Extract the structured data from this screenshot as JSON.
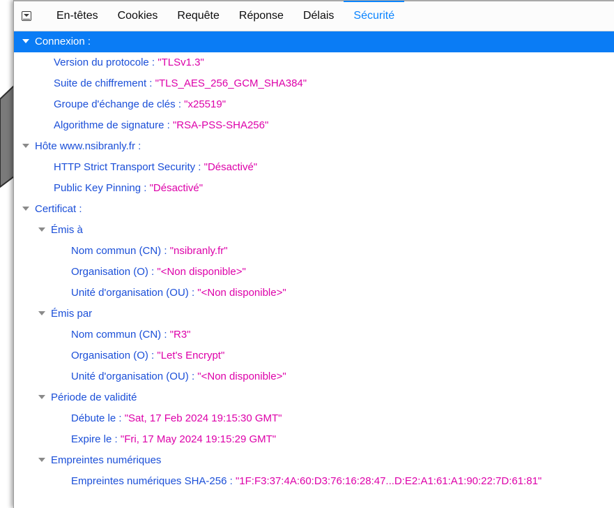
{
  "tabs": [
    {
      "label": "En-têtes",
      "active": false
    },
    {
      "label": "Cookies",
      "active": false
    },
    {
      "label": "Requête",
      "active": false
    },
    {
      "label": "Réponse",
      "active": false
    },
    {
      "label": "Délais",
      "active": false
    },
    {
      "label": "Sécurité",
      "active": true
    }
  ],
  "connexion": {
    "label": "Connexion :",
    "protocol": {
      "key": "Version du protocole : ",
      "value": "\"TLSv1.3\""
    },
    "cipher": {
      "key": "Suite de chiffrement : ",
      "value": "\"TLS_AES_256_GCM_SHA384\""
    },
    "keygroup": {
      "key": "Groupe d'échange de clés : ",
      "value": "\"x25519\""
    },
    "sigalgo": {
      "key": "Algorithme de signature : ",
      "value": "\"RSA-PSS-SHA256\""
    }
  },
  "host": {
    "label": "Hôte www.nsibranly.fr :",
    "hsts": {
      "key": "HTTP Strict Transport Security : ",
      "value": "\"Désactivé\""
    },
    "hpkp": {
      "key": "Public Key Pinning : ",
      "value": "\"Désactivé\""
    }
  },
  "certificate": {
    "label": "Certificat :",
    "issued_to": {
      "label": "Émis à",
      "cn": {
        "key": "Nom commun (CN) : ",
        "value": "\"nsibranly.fr\""
      },
      "o": {
        "key": "Organisation (O) : ",
        "value": "\"<Non disponible>\""
      },
      "ou": {
        "key": "Unité d'organisation (OU) : ",
        "value": "\"<Non disponible>\""
      }
    },
    "issued_by": {
      "label": "Émis par",
      "cn": {
        "key": "Nom commun (CN) : ",
        "value": "\"R3\""
      },
      "o": {
        "key": "Organisation (O) : ",
        "value": "\"Let's Encrypt\""
      },
      "ou": {
        "key": "Unité d'organisation (OU) : ",
        "value": "\"<Non disponible>\""
      }
    },
    "validity": {
      "label": "Période de validité",
      "begins": {
        "key": "Débute le : ",
        "value": "\"Sat, 17 Feb 2024 19:15:30 GMT\""
      },
      "expires": {
        "key": "Expire le : ",
        "value": "\"Fri, 17 May 2024 19:15:29 GMT\""
      }
    },
    "fingerprints": {
      "label": "Empreintes numériques",
      "sha256": {
        "key": "Empreintes numériques SHA-256 : ",
        "value": "\"1F:F3:37:4A:60:D3:76:16:28:47...D:E2:A1:61:A1:90:22:7D:61:81\""
      }
    }
  }
}
